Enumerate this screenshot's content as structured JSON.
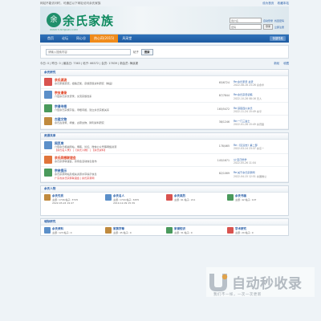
{
  "topbar": {
    "notice": "网站不能访问时，可通过以下网址访问余氏家族",
    "links": [
      "设为首页",
      "收藏本站"
    ]
  },
  "header": {
    "logo_mark": "余",
    "logo_text": "余氏家族",
    "logo_sub": "WWW.YUSHIJIAZU.COM",
    "username_placeholder": "用户名",
    "password_placeholder": "密码",
    "auto_login": "自动登录",
    "forgot": "找回密码",
    "login_btn": "登录",
    "register_btn": "立即注册"
  },
  "nav": {
    "items": [
      {
        "label": "首页",
        "active": false
      },
      {
        "label": "论坛",
        "active": false
      },
      {
        "label": "同心谷",
        "active": false
      },
      {
        "label": "热心莳(2015)",
        "active": true
      },
      {
        "label": "风采堂",
        "active": false
      }
    ],
    "quick": "快捷导航"
  },
  "search": {
    "placeholder": "请输入搜索内容",
    "scope": "帖子",
    "button": "搜索"
  },
  "stats": {
    "left": "今日: 0 | 昨日: 0 | 最高日: 7363 | 帖子: 66372 | 会员: 17639 | 新会员: 梅溪渠",
    "links": [
      "新帖",
      "收藏"
    ]
  },
  "sections": [
    {
      "title": "余氏研究",
      "forums": [
        {
          "name": "余氏源流",
          "desc": "余氏家族源流，祖籍迁徙，宗族谱牒资料研究（精品）",
          "links": "",
          "counts": "65/6724",
          "last_title": "Re:余氏家谱 总谱",
          "last_time": "2022-08-16 23:26 泉永华",
          "color": "#d9534f",
          "red": true
        },
        {
          "name": "宗支谱录",
          "desc": "介绍余氏宗支谱录，交流宗族世系",
          "links": "",
          "counts": "87/7844",
          "last_title": "Re:余氏宗谱初稿",
          "last_time": "2022-10-28 08:16 天人",
          "color": "#5b8fc9",
          "red": true
        },
        {
          "name": "宗谱寻根",
          "desc": "介绍余氏宗族字辈，寻根问祖，建立余氏宗族关系",
          "links": "",
          "counts": "165/5472",
          "last_title": "Re:深思四川余氏",
          "last_time": "2022-11-24 15:49 余平",
          "color": "#4a9a5c",
          "red": false
        },
        {
          "name": "古建文物",
          "desc": "余氏古建筑、祠堂、古墓文物、碑刻资料研究",
          "links": "",
          "counts": "38/1246",
          "last_title": "Re:一门三进士",
          "last_time": "2022-01-28 15:49 余蔚雯",
          "color": "#c08a3e",
          "red": false
        }
      ]
    },
    {
      "title": "资源共享",
      "forums": [
        {
          "name": "网页库",
          "desc": "介绍余氏相关网站、博客、论坛、微信公众号等网络资源",
          "links": "【余氏名人录】 | 【余氏人物】 | 【余氏资料】",
          "counts": "178/465",
          "last_title": "Re:《见清志》第二部",
          "last_time": "2022-03-14 23:37 余东一",
          "color": "#5b8fc9",
          "red": false
        },
        {
          "name": "余氏同根联谊会",
          "desc": "余氏宗亲联谊会、宗亲会活动信息发布",
          "links": "",
          "counts": "145/1671",
          "last_title": "以·自己修学",
          "last_time": "2022-05-26 11:04",
          "color": "#e0743a",
          "red": true
        },
        {
          "name": "宗亲提示",
          "desc": "余氏宗亲网站及相关资源共享提示信息",
          "links": "广东省余氏宗亲联谊会 | 余氏宗亲网",
          "counts": "82/1069",
          "last_title": "Re:关于余氏宗亲网",
          "last_time": "2022-04-15 12:51 余国维公",
          "color": "#4a9a5c",
          "red": false
        }
      ]
    },
    {
      "title": "余氏人物",
      "grid": [
        {
          "name": "余氏先贤",
          "a": "主题: 1746  帖子: 3725",
          "b": "2022-03-24 19:47",
          "color": "#c08a3e"
        },
        {
          "name": "余氏名人",
          "a": "主题: 1744  帖子: 3455",
          "b": "2019-12-09 15:39",
          "color": "#5b8fc9"
        },
        {
          "name": "余氏英烈",
          "a": "主题: 91  帖子: 211",
          "b": "",
          "color": "#d9534f"
        },
        {
          "name": "余氏书画",
          "a": "主题: 42  帖子: 107",
          "b": "",
          "color": "#4a9a5c"
        }
      ]
    },
    {
      "title": "城际研究",
      "grid": [
        {
          "name": "余氏资料",
          "a": "主题: 123  帖子: 0",
          "b": "",
          "color": "#5b8fc9"
        },
        {
          "name": "家族字辈",
          "a": "主题: 45  帖子: 0",
          "b": "",
          "color": "#c08a3e"
        },
        {
          "name": "家谱知识",
          "a": "主题: 31  帖子: 0",
          "b": "",
          "color": "#4a9a5c"
        },
        {
          "name": "学术研究",
          "a": "主题: 20  帖子: 0",
          "b": "",
          "color": "#d9534f"
        }
      ]
    }
  ],
  "watermark": {
    "brand": "自动秒收录",
    "sub": "我们不一样，一次一次更新"
  }
}
